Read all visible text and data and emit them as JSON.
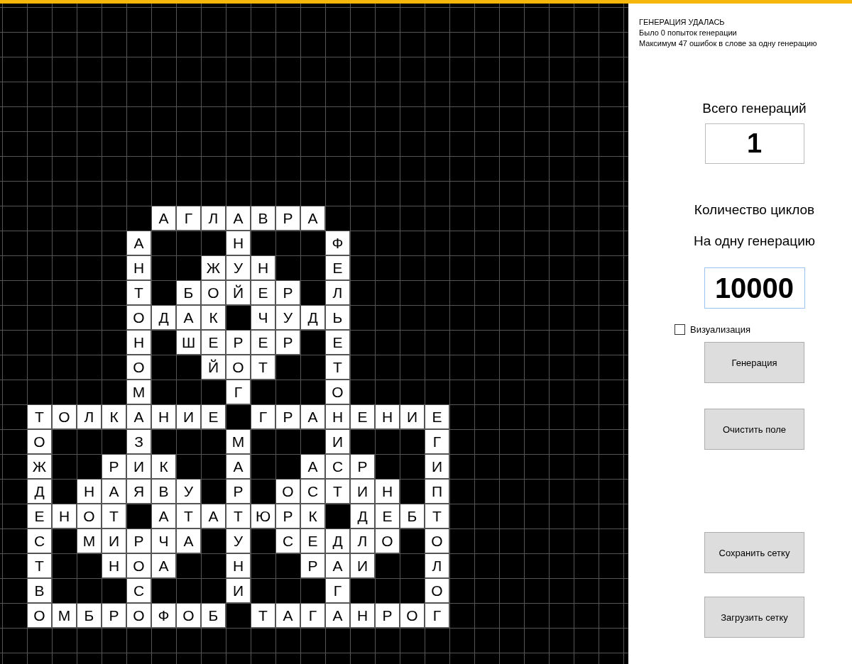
{
  "crossword": {
    "rows": [
      [
        null,
        null,
        null,
        null,
        null,
        null,
        "А",
        "Г",
        "Л",
        "А",
        "В",
        "Р",
        "А"
      ],
      [
        null,
        null,
        null,
        null,
        null,
        "А",
        null,
        null,
        null,
        "Н",
        null,
        null,
        null,
        "Ф"
      ],
      [
        null,
        null,
        null,
        null,
        null,
        "Н",
        null,
        null,
        "Ж",
        "У",
        "Н",
        null,
        null,
        "Е"
      ],
      [
        null,
        null,
        null,
        null,
        null,
        "Т",
        null,
        "Б",
        "О",
        "Й",
        "Е",
        "Р",
        null,
        "Л"
      ],
      [
        null,
        null,
        null,
        null,
        null,
        "О",
        "Д",
        "А",
        "К",
        null,
        "Ч",
        "У",
        "Д",
        "Ь"
      ],
      [
        null,
        null,
        null,
        null,
        null,
        "Н",
        null,
        "Ш",
        "Е",
        "Р",
        "Е",
        "Р",
        null,
        "Е"
      ],
      [
        null,
        null,
        null,
        null,
        null,
        "О",
        null,
        null,
        "Й",
        "О",
        "Т",
        null,
        null,
        "Т"
      ],
      [
        null,
        null,
        null,
        null,
        null,
        "М",
        null,
        null,
        null,
        "Г",
        null,
        null,
        null,
        "О"
      ],
      [
        null,
        "Т",
        "О",
        "Л",
        "К",
        "А",
        "Н",
        "И",
        "Е",
        null,
        "Г",
        "Р",
        "А",
        "Н",
        "Е",
        "Н",
        "И",
        "Е"
      ],
      [
        null,
        "О",
        null,
        null,
        null,
        "З",
        null,
        null,
        null,
        "М",
        null,
        null,
        null,
        "И",
        null,
        null,
        null,
        "Г"
      ],
      [
        null,
        "Ж",
        null,
        null,
        "Р",
        "И",
        "К",
        null,
        null,
        "А",
        null,
        null,
        "А",
        "С",
        "Р",
        null,
        null,
        "И"
      ],
      [
        null,
        "Д",
        null,
        "Н",
        "А",
        "Я",
        "В",
        "У",
        null,
        "Р",
        null,
        "О",
        "С",
        "Т",
        "И",
        "Н",
        null,
        "П"
      ],
      [
        null,
        "Е",
        "Н",
        "О",
        "Т",
        null,
        "А",
        "Т",
        "А",
        "Т",
        "Ю",
        "Р",
        "К",
        null,
        "Д",
        "Е",
        "Б",
        "Т"
      ],
      [
        null,
        "С",
        null,
        "М",
        "И",
        "Р",
        "Ч",
        "А",
        null,
        "У",
        null,
        "С",
        "Е",
        "Д",
        "Л",
        "О",
        null,
        "О"
      ],
      [
        null,
        "Т",
        null,
        null,
        "Н",
        "О",
        "А",
        null,
        null,
        "Н",
        null,
        null,
        "Р",
        "А",
        "И",
        null,
        null,
        "Л"
      ],
      [
        null,
        "В",
        null,
        null,
        null,
        "С",
        null,
        null,
        null,
        "И",
        null,
        null,
        null,
        "Г",
        null,
        null,
        null,
        "О"
      ],
      [
        null,
        "О",
        "М",
        "Б",
        "Р",
        "О",
        "Ф",
        "О",
        "Б",
        null,
        "Т",
        "А",
        "Г",
        "А",
        "Н",
        "Р",
        "О",
        "Г"
      ]
    ]
  },
  "status": [
    "ГЕНЕРАЦИЯ УДАЛАСЬ",
    "Было 0 попыток генерации",
    "Максимум 47 ошибок в слове за одну генерацию"
  ],
  "total": {
    "label": "Всего генераций",
    "value": "1"
  },
  "cycles": {
    "label_1": "Количество циклов",
    "label_2": "На одну генерацию",
    "value": "10000"
  },
  "visualization": {
    "label": "Визуализация",
    "checked": false
  },
  "buttons_top": [
    "Генерация",
    "Очистить поле"
  ],
  "buttons_bottom": [
    "Сохранить сетку",
    "Загрузить сетку"
  ]
}
